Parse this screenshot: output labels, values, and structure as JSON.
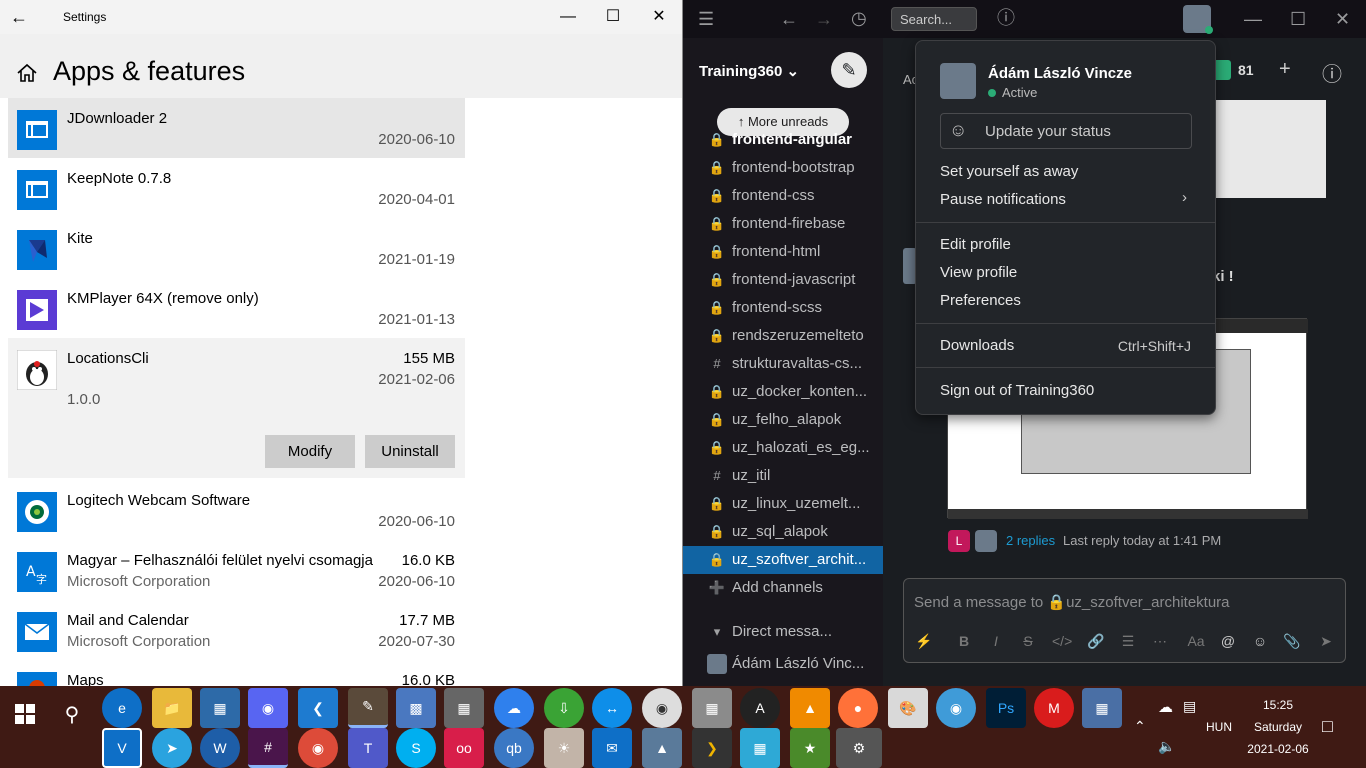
{
  "settings": {
    "window_title": "Settings",
    "page_title": "Apps & features",
    "apps": [
      {
        "name": "JDownloader 2",
        "date": "2020-06-10",
        "size": "",
        "publisher": "",
        "icon": "window-app-icon"
      },
      {
        "name": "KeepNote 0.7.8",
        "date": "2020-04-01",
        "size": "",
        "publisher": "",
        "icon": "window-app-icon"
      },
      {
        "name": "Kite",
        "date": "2021-01-19",
        "size": "",
        "publisher": "",
        "icon": "kite-icon"
      },
      {
        "name": "KMPlayer 64X (remove only)",
        "date": "2021-01-13",
        "size": "",
        "publisher": "",
        "icon": "kmplayer-icon"
      },
      {
        "name": "LocationsCli",
        "date": "2021-02-06",
        "size": "155 MB",
        "publisher": "",
        "version": "1.0.0",
        "icon": "java-icon"
      },
      {
        "name": "Logitech Webcam Software",
        "date": "2020-06-10",
        "size": "",
        "publisher": "",
        "icon": "logitech-icon"
      },
      {
        "name": "Magyar – Felhasználói felület nyelvi csomagja",
        "date": "2020-06-10",
        "size": "16.0 KB",
        "publisher": "Microsoft Corporation",
        "icon": "language-pack-icon"
      },
      {
        "name": "Mail and Calendar",
        "date": "2020-07-30",
        "size": "17.7 MB",
        "publisher": "Microsoft Corporation",
        "icon": "mail-icon"
      },
      {
        "name": "Maps",
        "date": "",
        "size": "16.0 KB",
        "publisher": "",
        "icon": "maps-icon"
      }
    ],
    "modify_label": "Modify",
    "uninstall_label": "Uninstall"
  },
  "slack": {
    "search_placeholder": "Search...",
    "workspace": "Training360",
    "more_unreads": "More unreads",
    "channels": [
      {
        "name": "frontend-angular",
        "prefix": "lock",
        "state": "bold"
      },
      {
        "name": "frontend-bootstrap",
        "prefix": "lock",
        "state": ""
      },
      {
        "name": "frontend-css",
        "prefix": "lock",
        "state": ""
      },
      {
        "name": "frontend-firebase",
        "prefix": "lock",
        "state": ""
      },
      {
        "name": "frontend-html",
        "prefix": "lock",
        "state": ""
      },
      {
        "name": "frontend-javascript",
        "prefix": "lock",
        "state": ""
      },
      {
        "name": "frontend-scss",
        "prefix": "lock",
        "state": ""
      },
      {
        "name": "rendszeruzemelteto",
        "prefix": "lock",
        "state": ""
      },
      {
        "name": "strukturavaltas-cs...",
        "prefix": "hash",
        "state": ""
      },
      {
        "name": "uz_docker_konten...",
        "prefix": "lock",
        "state": ""
      },
      {
        "name": "uz_felho_alapok",
        "prefix": "lock",
        "state": ""
      },
      {
        "name": "uz_halozati_es_eg...",
        "prefix": "lock",
        "state": ""
      },
      {
        "name": "uz_itil",
        "prefix": "hash",
        "state": ""
      },
      {
        "name": "uz_linux_uzemelt...",
        "prefix": "lock",
        "state": ""
      },
      {
        "name": "uz_sql_alapok",
        "prefix": "lock",
        "state": ""
      },
      {
        "name": "uz_szoftver_archit...",
        "prefix": "lock",
        "state": "active"
      }
    ],
    "add_channels": "Add channels",
    "direct_messages": "Direct messa...",
    "dm_user": "Ádám László Vinc...",
    "member_count": "81",
    "header_partial": "Ac",
    "message_partial": "ki !",
    "replies": "2 replies",
    "last_reply": "Last reply today at 1:41 PM",
    "message_placeholder": "Send a message to 🔒uz_szoftver_architektura",
    "menu": {
      "user_name": "Ádám László Vincze",
      "status": "Active",
      "update_status": "Update your status",
      "set_away": "Set yourself as away",
      "pause_notifications": "Pause notifications",
      "edit_profile": "Edit profile",
      "view_profile": "View profile",
      "preferences": "Preferences",
      "downloads": "Downloads",
      "downloads_shortcut": "Ctrl+Shift+J",
      "sign_out": "Sign out of Training360"
    }
  },
  "taskbar": {
    "time": "15:25",
    "day": "Saturday",
    "date": "2021-02-06",
    "language": "HUN"
  }
}
